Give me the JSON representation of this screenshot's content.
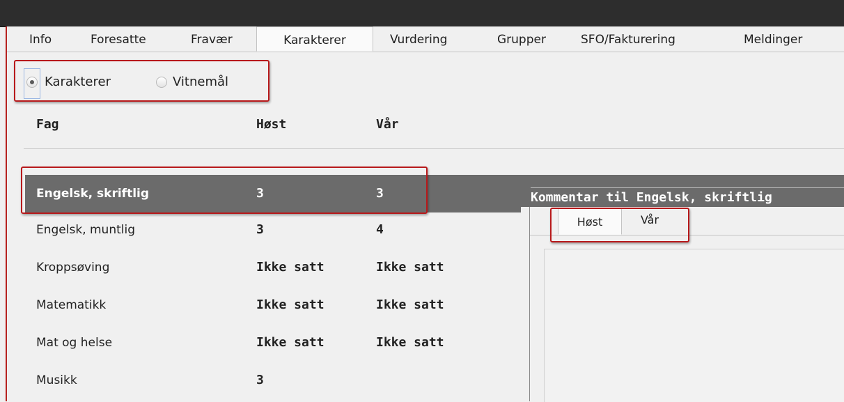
{
  "tabs": [
    {
      "label": "Info",
      "active": false
    },
    {
      "label": "Foresatte",
      "active": false
    },
    {
      "label": "Fravær",
      "active": false
    },
    {
      "label": "Karakterer",
      "active": true
    },
    {
      "label": "Vurdering",
      "active": false
    },
    {
      "label": "Grupper",
      "active": false
    },
    {
      "label": "SFO/Fakturering",
      "active": false
    },
    {
      "label": "Meldinger",
      "active": false
    }
  ],
  "view_toggle": {
    "options": [
      {
        "label": "Karakterer",
        "selected": true
      },
      {
        "label": "Vitnemål",
        "selected": false
      }
    ]
  },
  "grades_table": {
    "columns": [
      "Fag",
      "Høst",
      "Vår"
    ],
    "rows": [
      {
        "subject": "Engelsk, skriftlig",
        "host": "3",
        "var": "3",
        "selected": true
      },
      {
        "subject": "Engelsk, muntlig",
        "host": "3",
        "var": "4",
        "selected": false
      },
      {
        "subject": "Kroppsøving",
        "host": "Ikke satt",
        "var": "Ikke satt",
        "selected": false
      },
      {
        "subject": "Matematikk",
        "host": "Ikke satt",
        "var": "Ikke satt",
        "selected": false
      },
      {
        "subject": "Mat og helse",
        "host": "Ikke satt",
        "var": "Ikke satt",
        "selected": false
      },
      {
        "subject": "Musikk",
        "host": "3",
        "var": "",
        "selected": false
      }
    ]
  },
  "comment_panel": {
    "title": "Kommentar til Engelsk, skriftlig",
    "tabs": [
      {
        "label": "Høst",
        "active": true
      },
      {
        "label": "Vår",
        "active": false
      }
    ],
    "text": ""
  },
  "colors": {
    "selected_row": "#6b6b6b",
    "highlight_box": "#b8191b",
    "title_bar": "#2d2d2d"
  }
}
